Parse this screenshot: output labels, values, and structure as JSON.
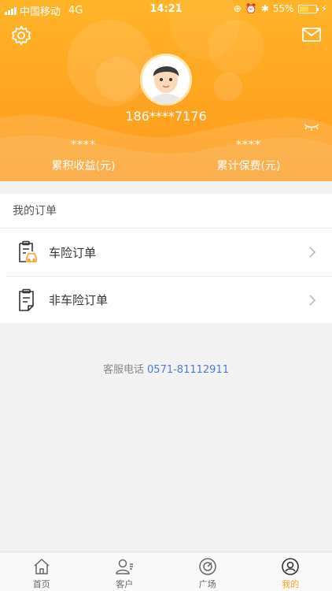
{
  "status": {
    "carrier": "中国移动",
    "network": "4G",
    "time": "14:21",
    "battery": "55%",
    "battery_level": 0.55
  },
  "header": {
    "phone": "186****7176",
    "stats": [
      {
        "value": "****",
        "label": "累积收益(元)"
      },
      {
        "value": "****",
        "label": "累计保费(元)"
      }
    ]
  },
  "orders": {
    "title": "我的订单",
    "items": [
      {
        "label": "车险订单",
        "icon": "car-insurance-order-icon"
      },
      {
        "label": "非车险订单",
        "icon": "document-order-icon"
      }
    ]
  },
  "service": {
    "label": "客服电话",
    "phone": "0571-81112911"
  },
  "tabs": [
    {
      "label": "首页",
      "icon": "home-icon",
      "active": false
    },
    {
      "label": "客户",
      "icon": "customer-icon",
      "active": false
    },
    {
      "label": "广场",
      "icon": "plaza-icon",
      "active": false
    },
    {
      "label": "我的",
      "icon": "profile-icon",
      "active": true
    }
  ],
  "colors": {
    "accent": "#ff9d1e",
    "link": "#4b7bd6"
  }
}
